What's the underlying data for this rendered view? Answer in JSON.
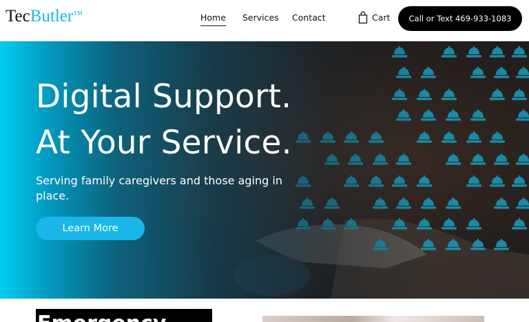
{
  "header": {
    "logo": {
      "part1": "Tec",
      "part2": "Butler",
      "mark": "™"
    },
    "nav": [
      {
        "label": "Home",
        "active": true
      },
      {
        "label": "Services"
      },
      {
        "label": "Contact"
      }
    ],
    "cart": {
      "label": "Cart",
      "icon": "shopping-bag-icon"
    },
    "call_button": "Call or Text 469-933-1083"
  },
  "hero": {
    "title_line1": "Digital Support.",
    "title_line2": "At Your Service.",
    "subtitle": "Serving family caregivers and those aging in place.",
    "cta": "Learn More",
    "background_image": "hand-pressing-service-bell-icon"
  },
  "below_fold": {
    "emergency_heading": "Emergency"
  },
  "colors": {
    "accent": "#16b8e6",
    "button_dark": "#000000",
    "hero_gradient_start": "#00cdf0",
    "bell_pattern": "#1a8aa6"
  }
}
